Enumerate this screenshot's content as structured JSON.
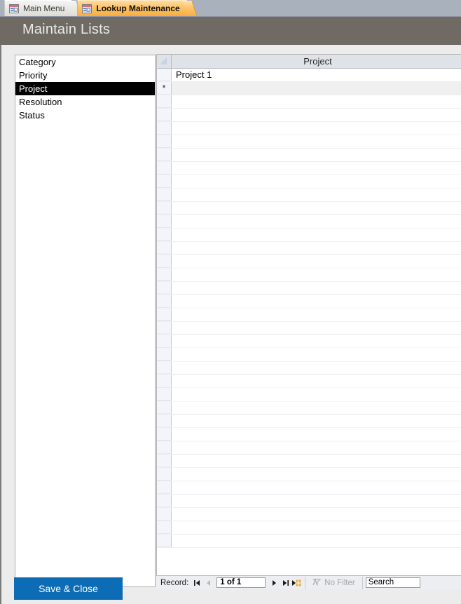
{
  "window": {
    "tabs": [
      {
        "label": "Main Menu",
        "icon": "form-icon",
        "active": false
      },
      {
        "label": "Lookup Maintenance",
        "icon": "form-icon",
        "active": true
      }
    ]
  },
  "header": {
    "title": "Maintain Lists",
    "background_color": "#6f6b64",
    "text_color": "#eceae6"
  },
  "lists_listbox": {
    "name": "lookup-lists",
    "items": [
      {
        "label": "Category",
        "selected": false
      },
      {
        "label": "Priority",
        "selected": false
      },
      {
        "label": "Project",
        "selected": true
      },
      {
        "label": "Resolution",
        "selected": false
      },
      {
        "label": "Status",
        "selected": false
      }
    ],
    "selected_value": "Project",
    "selection_background": "#000000",
    "selection_text_color": "#ffffff"
  },
  "datasheet": {
    "column_header": "Project",
    "rows": [
      {
        "selector": "",
        "value": "Project 1",
        "type": "data"
      },
      {
        "selector": "*",
        "value": "",
        "type": "new-record"
      }
    ],
    "blank_row_count": 34
  },
  "record_nav": {
    "label": "Record:",
    "first_label": "First record",
    "previous_label": "Previous record",
    "position": "1 of 1",
    "next_label": "Next record",
    "last_label": "Last record",
    "new_label": "New (blank) record",
    "filter_label": "No Filter",
    "filter_enabled": false,
    "search_placeholder": "Search",
    "search_value": "Search"
  },
  "footer": {
    "save_close_label": "Save & Close",
    "save_close_color": "#0c6cb5"
  }
}
